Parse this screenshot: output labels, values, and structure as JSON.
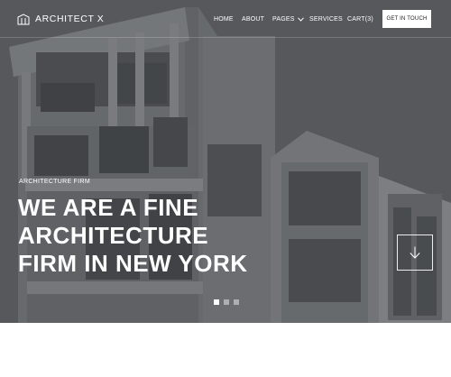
{
  "brand": {
    "name": "ARCHITECT X",
    "icon": "building-icon"
  },
  "nav": {
    "items": [
      {
        "label": "HOME"
      },
      {
        "label": "ABOUT"
      },
      {
        "label": "PAGES",
        "icon": "chevron-down-icon"
      },
      {
        "label": "SERVICES"
      },
      {
        "label": "CART(3)"
      }
    ],
    "cta_label": "GET IN TOUCH"
  },
  "hero": {
    "eyebrow": "ARCHITECTURE FIRM",
    "headline_lines": [
      "WE ARE A FINE",
      "ARCHITECTURE",
      "FIRM IN NEW YORK"
    ],
    "scroll_icon": "arrow-down-icon",
    "slides": {
      "count": 3,
      "active": 1
    }
  },
  "colors": {
    "overlay": "#5d6063",
    "text": "#ffffff",
    "cta_bg": "#ffffff",
    "cta_text": "#1b1b1b",
    "page_bg": "#ffffff"
  }
}
